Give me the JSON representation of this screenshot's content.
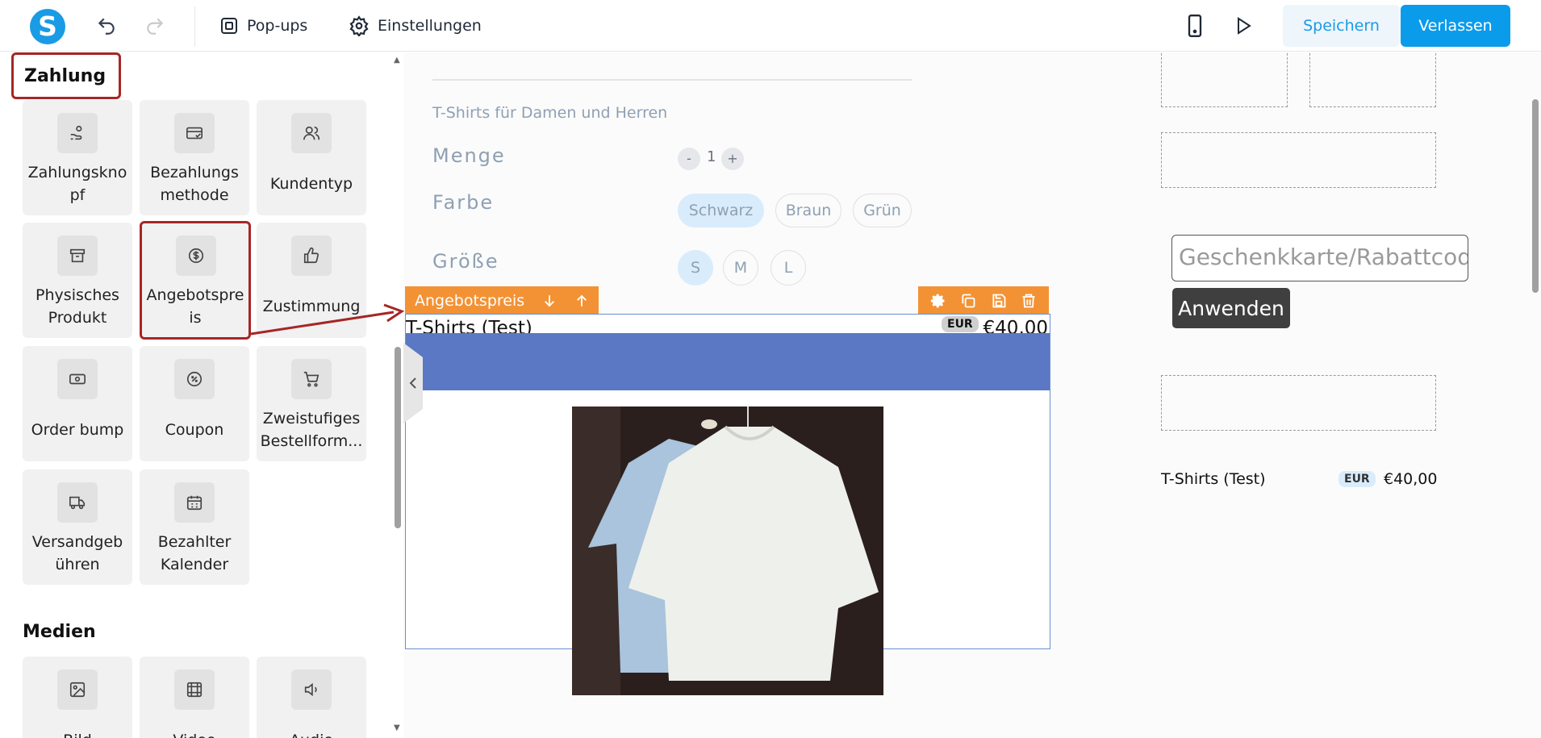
{
  "topbar": {
    "logo_letter": "S",
    "popups_label": "Pop-ups",
    "settings_label": "Einstellungen",
    "save_label": "Speichern",
    "leave_label": "Verlassen"
  },
  "left": {
    "payment_section": "Zahlung",
    "media_section": "Medien",
    "tiles": [
      {
        "label": "Zahlungsknopf",
        "line1": "Zahlungskno",
        "line2": "pf",
        "icon": "hand-coin-icon"
      },
      {
        "label": "Bezahlungsmethode",
        "line1": "Bezahlungs",
        "line2": "methode",
        "icon": "card-check-icon"
      },
      {
        "label": "Kundentyp",
        "icon": "users-icon"
      },
      {
        "label": "Physisches Produkt",
        "line1": "Physisches",
        "line2": "Produkt",
        "icon": "archive-box-icon"
      },
      {
        "label": "Angebotspreis",
        "line1": "Angebotspre",
        "line2": "is",
        "icon": "dollar-coin-icon"
      },
      {
        "label": "Zustimmung",
        "icon": "thumbs-up-icon"
      },
      {
        "label": "Order bump",
        "icon": "cash-icon"
      },
      {
        "label": "Coupon",
        "icon": "percent-badge-icon"
      },
      {
        "label": "Zweistufiges Bestellform...",
        "line1": "Zweistufiges",
        "line2": "Bestellform...",
        "icon": "cart-icon"
      },
      {
        "label": "Versandgebühren",
        "line1": "Versandgeb",
        "line2": "ühren",
        "icon": "truck-icon"
      },
      {
        "label": "Bezahlter Kalender",
        "line1": "Bezahlter",
        "line2": "Kalender",
        "icon": "calendar-icon"
      }
    ],
    "media_tiles": [
      {
        "label": "Bild",
        "icon": "image-icon"
      },
      {
        "label": "Video",
        "icon": "film-icon"
      },
      {
        "label": "Audio",
        "icon": "speaker-icon"
      }
    ]
  },
  "canvas": {
    "product_subtitle": "T-Shirts für Damen und Herren",
    "quantity_label": "Menge",
    "quantity_minus": "-",
    "quantity_value": "1",
    "quantity_plus": "+",
    "color_label": "Farbe",
    "colors": [
      "Schwarz",
      "Braun",
      "Grün"
    ],
    "size_label": "Größe",
    "sizes": [
      "S",
      "M",
      "L"
    ],
    "selected_element_label": "Angebotspreis",
    "product_title": "T-Shirts (Test)",
    "currency_badge": "EUR",
    "price": "€40,00",
    "gift_placeholder": "Geschenkkarte/Rabattcode",
    "apply_label": "Anwenden",
    "summary_title": "T-Shirts (Test)",
    "summary_currency": "EUR",
    "summary_price": "€40,00"
  },
  "colors": {
    "accent": "#1a9be6",
    "highlight": "#a62626",
    "selection": "#f39234",
    "banner": "#5a78c4"
  }
}
